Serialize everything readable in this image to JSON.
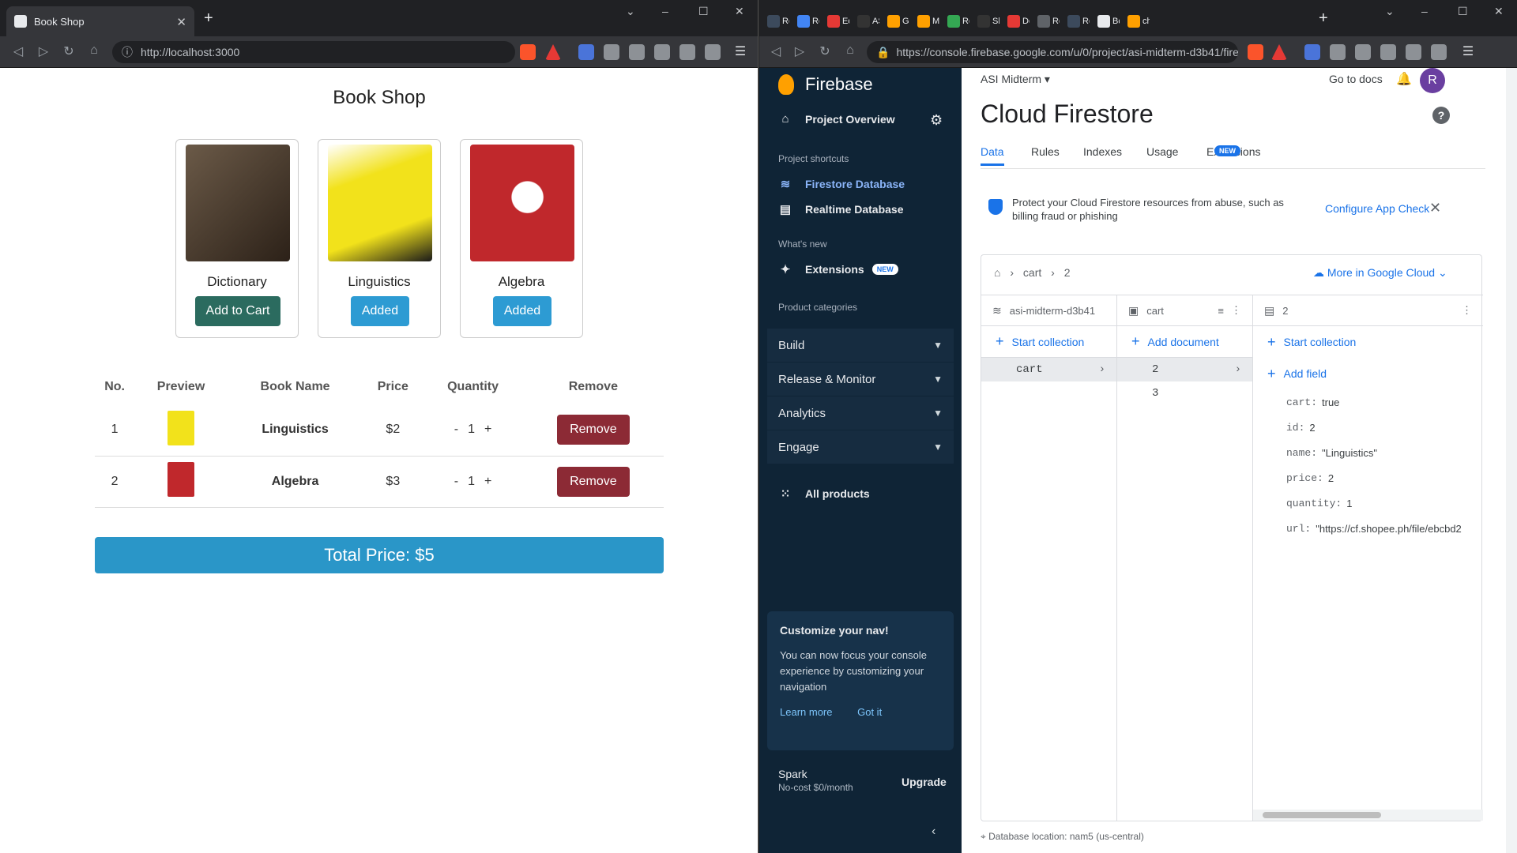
{
  "left_browser": {
    "tab_title": "Book Shop",
    "new_tab": "+",
    "url": "http://localhost:3000"
  },
  "right_browser": {
    "tabs": [
      "Re",
      "Re",
      "Ed",
      "AS",
      "Ge",
      "M",
      "Re",
      "Sh",
      "Dc",
      "Re",
      "Re",
      "Bc",
      "ch"
    ],
    "url": "https://console.firebase.google.com/u/0/project/asi-midterm-d3b41/fires..."
  },
  "shop": {
    "title": "Book Shop",
    "cards": [
      {
        "name": "Dictionary",
        "button": "Add to Cart",
        "cover_color": "#4a3a2c"
      },
      {
        "name": "Linguistics",
        "button": "Added",
        "cover_color": "#f2e21b"
      },
      {
        "name": "Algebra",
        "button": "Added",
        "cover_color": "#c0282c"
      }
    ],
    "table": {
      "headers": [
        "No.",
        "Preview",
        "Book Name",
        "Price",
        "Quantity",
        "Remove"
      ],
      "rows": [
        {
          "no": "1",
          "name": "Linguistics",
          "price": "$2",
          "minus": "-",
          "qty": "1",
          "plus": "+",
          "remove": "Remove",
          "thumb_color": "#f2e21b"
        },
        {
          "no": "2",
          "name": "Algebra",
          "price": "$3",
          "minus": "-",
          "qty": "1",
          "plus": "+",
          "remove": "Remove",
          "thumb_color": "#c0282c"
        }
      ]
    },
    "total": "Total Price: $5"
  },
  "firebase": {
    "brand": "Firebase",
    "project_overview": "Project Overview",
    "shortcuts_head": "Project shortcuts",
    "shortcuts": [
      "Firestore Database",
      "Realtime Database"
    ],
    "whats_new": "What's new",
    "extensions": "Extensions",
    "new_badge": "NEW",
    "categories_head": "Product categories",
    "categories": [
      "Build",
      "Release & Monitor",
      "Analytics",
      "Engage"
    ],
    "all_products": "All products",
    "customize": {
      "title": "Customize your nav!",
      "body": "You can now focus your console experience by customizing your navigation",
      "learn": "Learn more",
      "got": "Got it"
    },
    "plan": "Spark",
    "plan_sub": "No-cost $0/month",
    "upgrade": "Upgrade",
    "project_name": "ASI Midterm",
    "go_to_docs": "Go to docs",
    "avatar_letter": "R",
    "page_title": "Cloud Firestore",
    "tabs": [
      "Data",
      "Rules",
      "Indexes",
      "Usage",
      "Extensions"
    ],
    "banner_text": "Protect your Cloud Firestore resources from abuse, such as billing fraud or phishing",
    "banner_cta": "Configure App Check",
    "crumb_collection": "cart",
    "crumb_doc": "2",
    "more_gc": "More in Google Cloud",
    "col1_head": "asi-midterm-d3b41",
    "col2_head": "cart",
    "col3_head": "2",
    "start_collection": "Start collection",
    "add_document": "Add document",
    "add_field": "Add field",
    "collections": [
      "cart"
    ],
    "documents": [
      "2",
      "3"
    ],
    "fields": [
      {
        "k": "cart:",
        "v": "true"
      },
      {
        "k": "id:",
        "v": "2"
      },
      {
        "k": "name:",
        "v": "\"Linguistics\""
      },
      {
        "k": "price:",
        "v": "2"
      },
      {
        "k": "quantity:",
        "v": "1"
      },
      {
        "k": "url:",
        "v": "\"https://cf.shopee.ph/file/ebcbd2"
      }
    ],
    "db_location": "Database location: nam5 (us-central)"
  }
}
